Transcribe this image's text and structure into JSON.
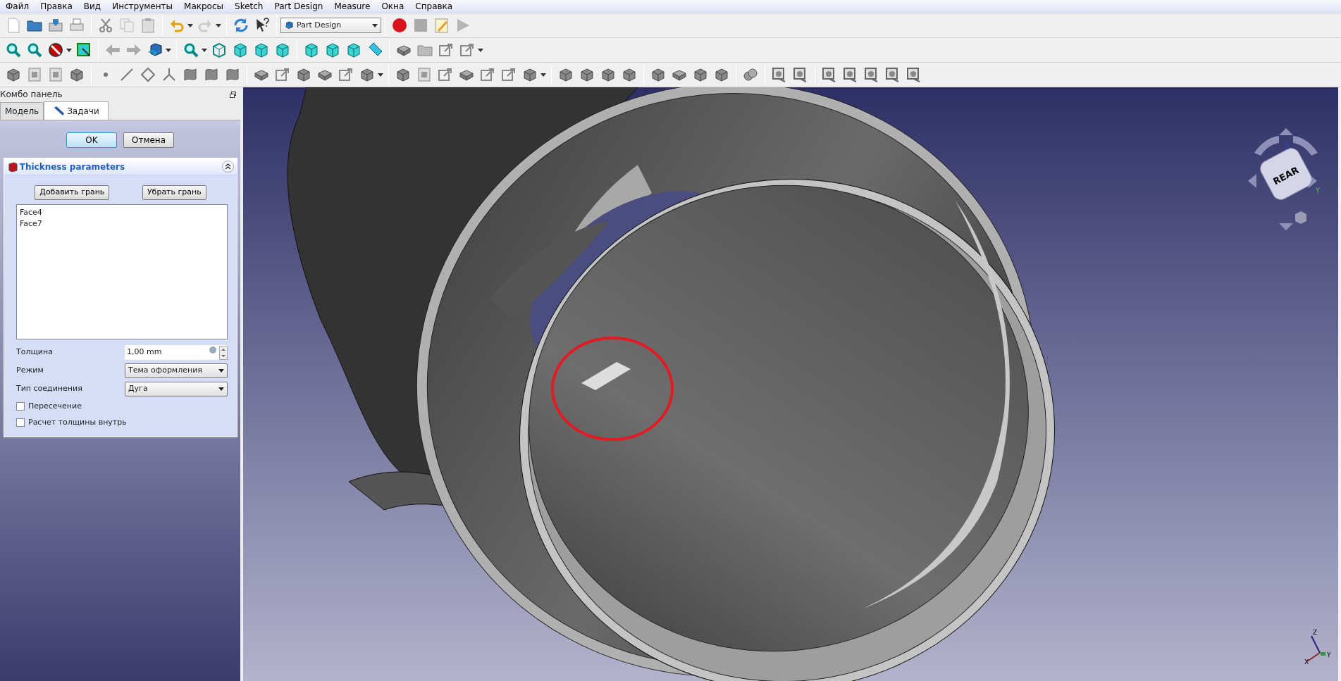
{
  "menu": [
    "Файл",
    "Правка",
    "Вид",
    "Инструменты",
    "Макросы",
    "Sketch",
    "Part Design",
    "Measure",
    "Окна",
    "Справка"
  ],
  "workbench": {
    "value": "Part Design"
  },
  "combo_panel": {
    "title": "Комбо панель",
    "tabs": [
      {
        "label": "Модель",
        "selected": false
      },
      {
        "label": "Задачи",
        "selected": true
      }
    ],
    "buttons": [
      {
        "label": "OK",
        "selected": true
      },
      {
        "label": "Отмена",
        "selected": false
      }
    ],
    "task": {
      "title": "Thickness parameters",
      "expanded": true,
      "buttons": [
        "Добавить грань",
        "Убрать грань"
      ],
      "faces": [
        "Face4",
        "Face7"
      ],
      "fields": [
        {
          "kind": "spin",
          "label": "Толщина",
          "value": "1,00 mm"
        },
        {
          "kind": "select",
          "label": "Режим",
          "value": "Тема оформления"
        },
        {
          "kind": "select",
          "label": "Тип соединения",
          "value": "Дуга"
        }
      ],
      "checkboxes": [
        {
          "label": "Пересечение",
          "checked": false
        },
        {
          "label": "Расчет толщины внутрь",
          "checked": false
        }
      ]
    }
  },
  "view": {
    "nav_cube": {
      "face": "REAR",
      "axes": [
        "Z",
        "Y"
      ]
    },
    "triad": [
      "Z",
      "Y",
      "X"
    ]
  }
}
